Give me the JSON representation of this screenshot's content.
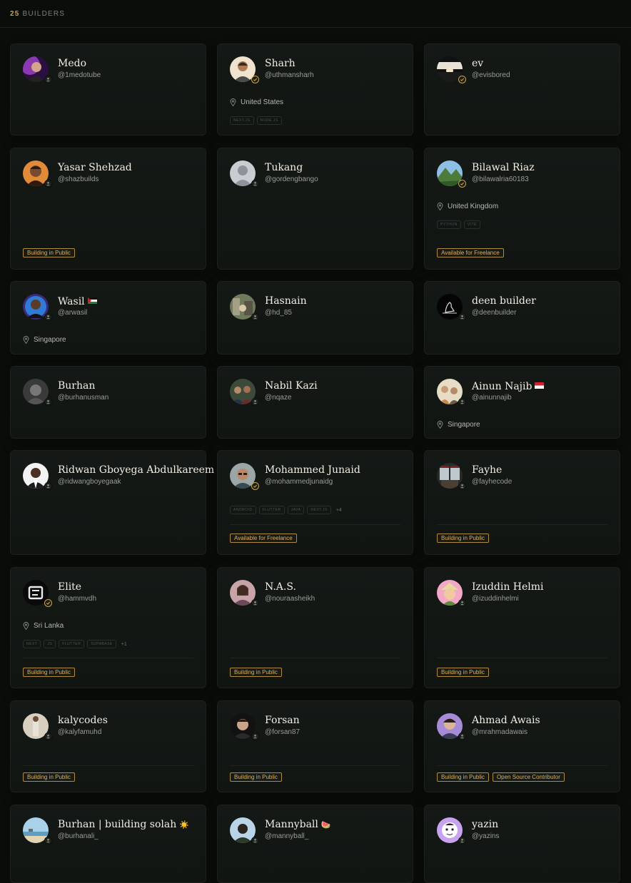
{
  "header": {
    "count": "25",
    "label": "BUILDERS"
  },
  "colors": {
    "accent": "#c9a24e",
    "background": "#0b0d0b",
    "card": "#131815"
  },
  "builders": [
    {
      "name": "Medo",
      "handle": "@1medotube",
      "avatar": "purple-glow-photo",
      "verified": false
    },
    {
      "name": "Sharh",
      "handle": "@uthmansharh",
      "avatar": "beige-portrait-photo",
      "verified": true,
      "location": "United States",
      "techs": [
        "NEXT.JS",
        "NODE.JS"
      ]
    },
    {
      "name": "ev",
      "handle": "@evisbored",
      "avatar": "dark-sunset-photo",
      "verified": true
    },
    {
      "name": "Yasar Shehzad",
      "handle": "@shazbuilds",
      "avatar": "orange-portrait-photo",
      "verified": false,
      "badges": [
        "Building in Public"
      ]
    },
    {
      "name": "Tukang",
      "handle": "@gordengbango",
      "avatar": "default-user-avatar",
      "verified": false
    },
    {
      "name": "Bilawal Riaz",
      "handle": "@bilawalria60183",
      "avatar": "mountain-landscape-photo",
      "verified": true,
      "location": "United Kingdom",
      "techs": [
        "PYTHON",
        "VITE"
      ],
      "badges": [
        "Available for Freelance"
      ]
    },
    {
      "name": "Wasil",
      "flag": "palestine-flag",
      "handle": "@arwasil",
      "avatar": "blue-portrait-photo",
      "verified": false,
      "location": "Singapore"
    },
    {
      "name": "Hasnain",
      "handle": "@hd_85",
      "avatar": "outdoor-photo",
      "verified": false
    },
    {
      "name": "deen builder",
      "handle": "@deenbuilder",
      "avatar": "prayer-silhouette-logo",
      "verified": false
    },
    {
      "name": "Burhan",
      "handle": "@burhanusman",
      "avatar": "grey-portrait-photo",
      "verified": false
    },
    {
      "name": "Nabil Kazi",
      "handle": "@nqaze",
      "avatar": "group-photo",
      "verified": false
    },
    {
      "name": "Ainun Najib",
      "flag": "indonesia-flag",
      "handle": "@ainunnajib",
      "avatar": "family-photo",
      "verified": false,
      "location": "Singapore"
    },
    {
      "name": "Ridwan Gboyega Abdulkareem",
      "handle": "@ridwangboyegaak",
      "avatar": "white-suit-photo",
      "verified": false
    },
    {
      "name": "Mohammed Junaid",
      "handle": "@mohammedjunaidg",
      "avatar": "glasses-portrait-photo",
      "verified": true,
      "techs": [
        "ANDROID",
        "FLUTTER",
        "JAVA",
        "NEXT.JS"
      ],
      "techs_more": "+4",
      "badges": [
        "Available for Freelance"
      ]
    },
    {
      "name": "Fayhe",
      "handle": "@fayhecode",
      "avatar": "window-scene-photo",
      "verified": false,
      "badges": [
        "Building in Public"
      ]
    },
    {
      "name": "Elite",
      "handle": "@hammvdh",
      "avatar": "monogram-logo",
      "verified": true,
      "location": "Sri Lanka",
      "techs": [
        "NEXT",
        "JS",
        "FLUTTER",
        "SUPABASE"
      ],
      "techs_more": "+1",
      "badges": [
        "Building in Public"
      ]
    },
    {
      "name": "N.A.S.",
      "handle": "@nouraasheikh",
      "avatar": "pink-portrait-photo",
      "verified": false,
      "badges": [
        "Building in Public"
      ]
    },
    {
      "name": "Izuddin Helmi",
      "handle": "@izuddinhelmi",
      "avatar": "cartoon-hat-avatar",
      "verified": false,
      "badges": [
        "Building in Public"
      ]
    },
    {
      "name": "kalycodes",
      "handle": "@kalyfamuhd",
      "avatar": "standing-photo",
      "verified": false,
      "badges": [
        "Building in Public"
      ]
    },
    {
      "name": "Forsan",
      "handle": "@forsan87",
      "avatar": "dark-portrait-photo",
      "verified": false,
      "badges": [
        "Building in Public"
      ]
    },
    {
      "name": "Ahmad Awais",
      "handle": "@mrahmadawais",
      "avatar": "purple-portrait-photo",
      "verified": false,
      "badges": [
        "Building in Public",
        "Open Source Contributor"
      ]
    },
    {
      "name": "Burhan | building solah",
      "emoji": "☀️",
      "handle": "@burhanali_",
      "avatar": "beach-photo",
      "verified": false
    },
    {
      "name": "Mannyball",
      "emoji": "🍉",
      "handle": "@mannyball_",
      "avatar": "sky-portrait-photo",
      "verified": false
    },
    {
      "name": "yazin",
      "handle": "@yazins",
      "avatar": "purple-cartoon-avatar",
      "verified": false
    }
  ]
}
